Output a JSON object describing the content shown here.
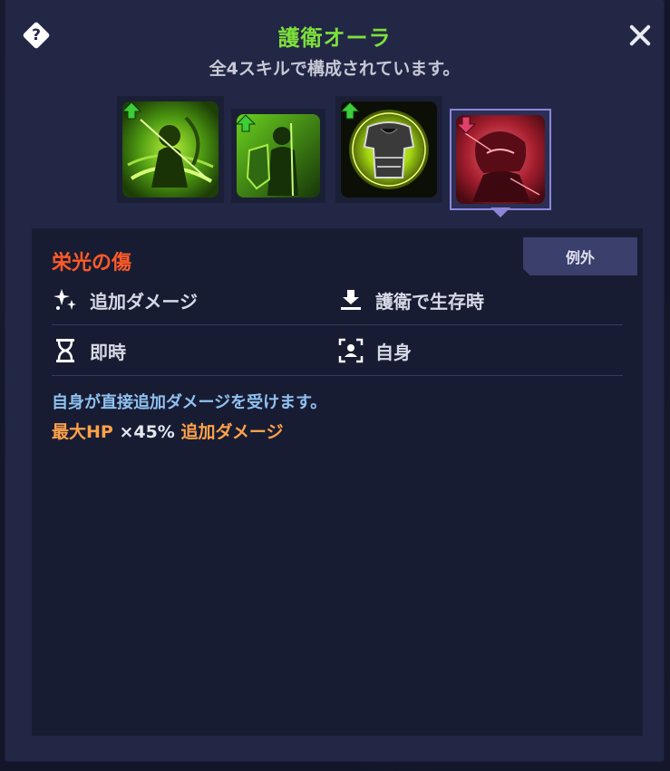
{
  "dialog": {
    "help_icon_glyph": "?",
    "title": "護衛オーラ",
    "subtitle": "全4スキルで構成されています。",
    "title_color": "#7ee03a"
  },
  "skills": [
    {
      "icon": "archer-skill-icon",
      "arrow": "up",
      "selected": false
    },
    {
      "icon": "shield-knight-skill-icon",
      "arrow": "up",
      "selected": false
    },
    {
      "icon": "armor-skill-icon",
      "arrow": "up",
      "selected": false
    },
    {
      "icon": "wounded-hero-skill-icon",
      "arrow": "down",
      "selected": true
    }
  ],
  "detail": {
    "name": "栄光の傷",
    "tag": "例外",
    "attributes": [
      {
        "icon": "sparkle-icon",
        "label": "追加ダメージ"
      },
      {
        "icon": "download-icon",
        "label": "護衛で生存時"
      },
      {
        "icon": "hourglass-icon",
        "label": "即時"
      },
      {
        "icon": "self-target-icon",
        "label": "自身"
      }
    ],
    "description": "自身が直接追加ダメージを受けます。",
    "effect": {
      "stat": "最大HP",
      "multiplier": " ×45% ",
      "result": "追加ダメージ"
    }
  },
  "colors": {
    "name": "#ff5a28",
    "description": "#8fc1ef",
    "effect_highlight": "#ffa24a",
    "up_arrow": "#3fcc3a",
    "down_arrow": "#e0406a"
  }
}
